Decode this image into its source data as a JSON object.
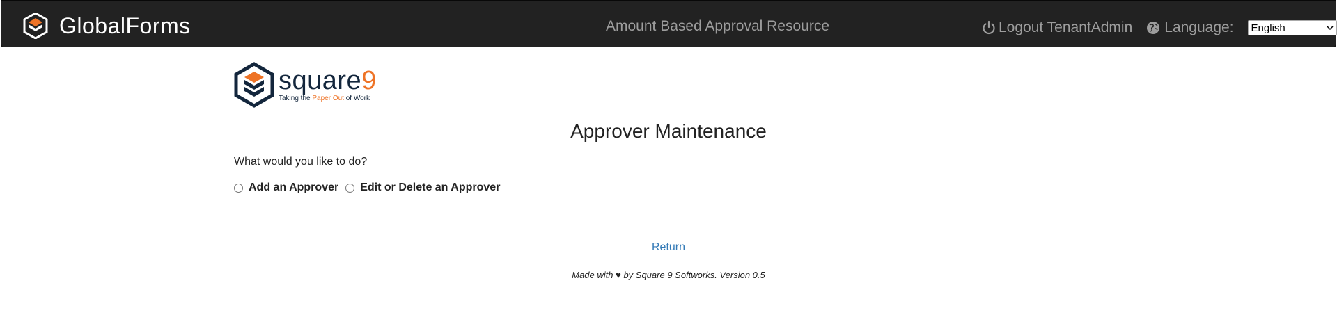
{
  "header": {
    "brand_name": "GlobalForms",
    "page_context": "Amount Based Approval Resource",
    "logout_label": "Logout TenantAdmin",
    "language_label": "Language:",
    "language_selected": "English"
  },
  "logo": {
    "word": "square",
    "nine": "9",
    "tagline_before": "Taking the ",
    "tagline_highlight": "Paper Out",
    "tagline_after": " of Work"
  },
  "main": {
    "title": "Approver Maintenance",
    "question": "What would you like to do?",
    "options": [
      {
        "label": "Add an Approver",
        "selected": false
      },
      {
        "label": "Edit or Delete an Approver",
        "selected": false
      }
    ],
    "return_label": "Return"
  },
  "footer": {
    "text": "Made with ♥ by Square 9 Softworks. Version 0.5"
  },
  "colors": {
    "navbar_bg": "#222222",
    "nav_text": "#9d9d9d",
    "brand_orange": "#ee7326",
    "brand_navy": "#13263c",
    "link": "#337ab7"
  },
  "icons": [
    "globalforms-logo-icon",
    "power-icon",
    "globe-icon",
    "square9-logo-icon",
    "chevron-down-icon"
  ]
}
